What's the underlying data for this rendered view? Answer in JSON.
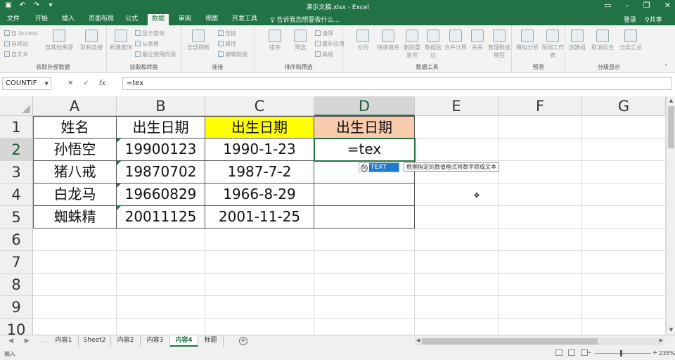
{
  "titlebar": {
    "title": "演示文稿.xlsx - Excel",
    "qat_icons": [
      "save-icon",
      "undo-icon",
      "redo-icon",
      "customize-qat-icon"
    ],
    "window_controls": [
      "ribbon-display-icon",
      "minimize-icon",
      "restore-icon",
      "close-icon"
    ]
  },
  "tabs": [
    "文件",
    "开始",
    "插入",
    "页面布局",
    "公式",
    "数据",
    "审阅",
    "视图",
    "开发工具"
  ],
  "active_tab": "数据",
  "tellme": "告诉我您想要做什么...",
  "account": {
    "login": "登录",
    "share": "共享"
  },
  "ribbon": {
    "groups": [
      {
        "label": "获取外部数据",
        "small_items": [
          "自 Access",
          "自网站",
          "自文本"
        ],
        "buttons": [
          "自其他来源",
          "现有连接"
        ]
      },
      {
        "label": "获取和转换",
        "buttons": [
          "新建查询"
        ],
        "small_items": [
          "显示查询",
          "从表格",
          "最近使用的源"
        ]
      },
      {
        "label": "连接",
        "buttons": [
          "全部刷新"
        ],
        "small_items": [
          "连接",
          "属性",
          "编辑链接"
        ]
      },
      {
        "label": "排序和筛选",
        "buttons": [
          "排序",
          "筛选"
        ],
        "small_items": [
          "清除",
          "重新应用",
          "高级"
        ]
      },
      {
        "label": "数据工具",
        "buttons": [
          "分列",
          "快速填充",
          "删除重复项",
          "数据验证",
          "合并计算",
          "关系",
          "管理数据模型"
        ]
      },
      {
        "label": "预测",
        "buttons": [
          "模拟分析",
          "预测工作表"
        ]
      },
      {
        "label": "分级显示",
        "buttons": [
          "创建组",
          "取消组合",
          "分类汇总"
        ]
      }
    ]
  },
  "formula_bar": {
    "name_box": "COUNTIF",
    "cancel": "✕",
    "enter": "✓",
    "fx": "fx",
    "formula": "=tex"
  },
  "sheet": {
    "columns": [
      "A",
      "B",
      "C",
      "D",
      "E",
      "F",
      "G"
    ],
    "rows": [
      "1",
      "2",
      "3",
      "4",
      "5",
      "6",
      "7",
      "8",
      "9",
      "10"
    ],
    "cells": {
      "A1": "姓名",
      "B1": "出生日期",
      "C1": "出生日期",
      "D1": "出生日期",
      "A2": "孙悟空",
      "B2": "19900123",
      "C2": "1990-1-23",
      "D2": "=tex",
      "A3": "猪八戒",
      "B3": "19870702",
      "C3": "1987-7-2",
      "A4": "白龙马",
      "B4": "19660829",
      "C4": "1966-8-29",
      "A5": "蜘蛛精",
      "B5": "20011125",
      "C5": "2001-11-25"
    },
    "active_cell": "D2",
    "colors": {
      "C1_fill": "#ffff00",
      "D1_fill": "#f8cbad",
      "accent": "#217346"
    }
  },
  "autocomplete": {
    "function": "TEXT",
    "tooltip": "根据指定的数值格式将数字转成文本"
  },
  "sheet_tabs": [
    "内容1",
    "Sheet2",
    "内容2",
    "内容3",
    "内容4",
    "标题"
  ],
  "active_sheet": "内容4",
  "status": {
    "mode": "输入",
    "zoom": "235%"
  }
}
